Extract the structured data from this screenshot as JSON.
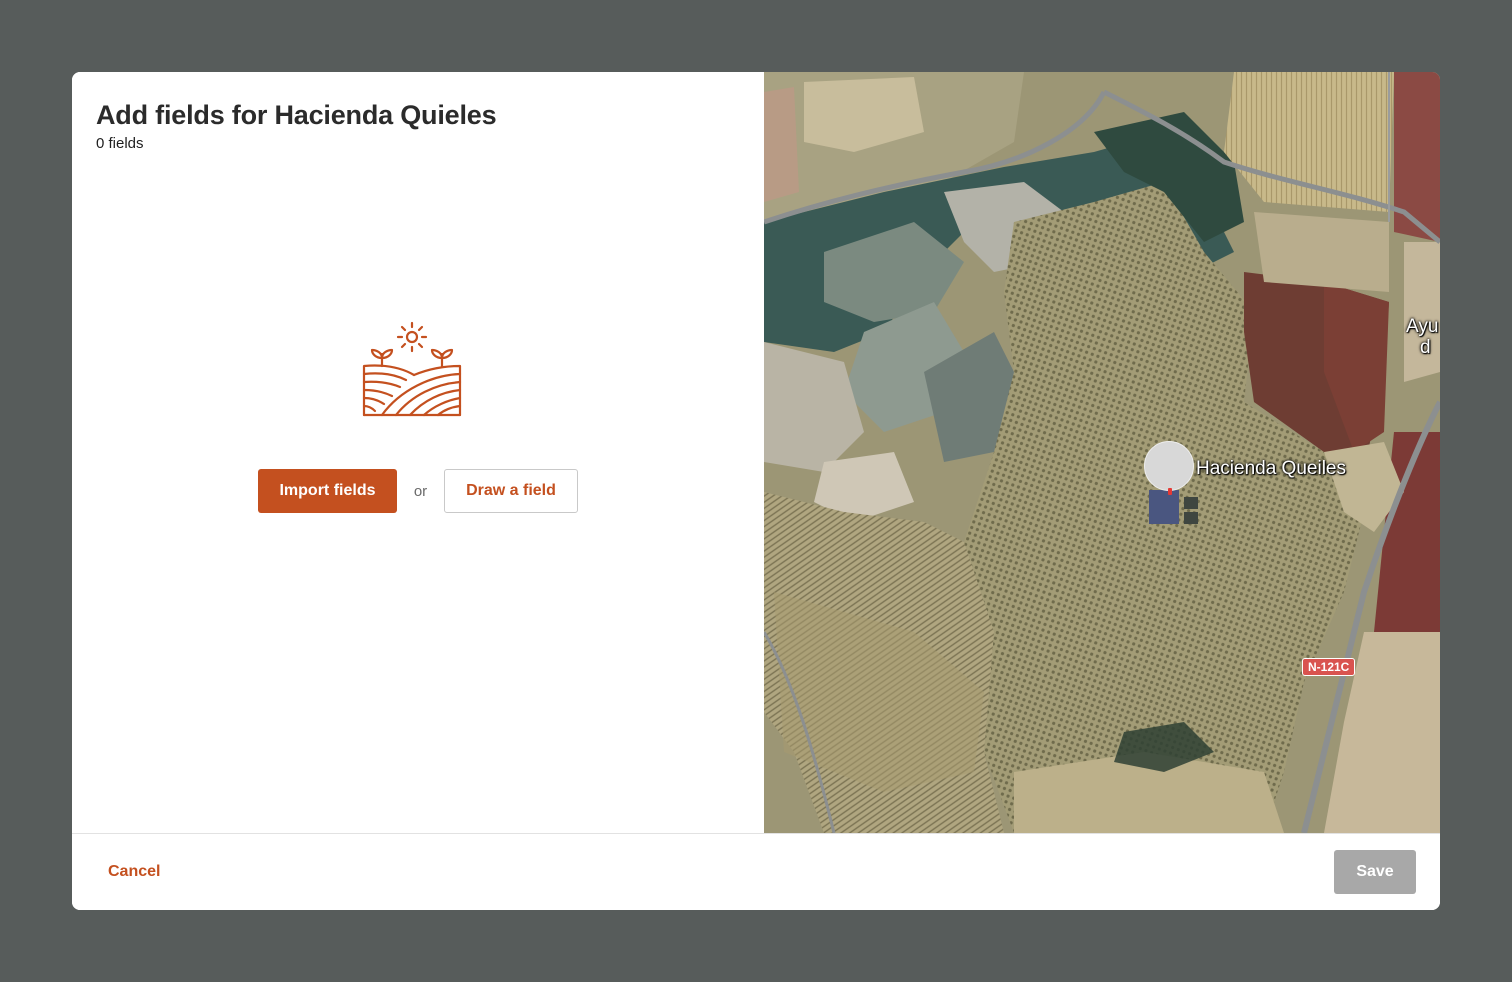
{
  "modal": {
    "title": "Add fields for Hacienda Quieles",
    "field_count": "0 fields"
  },
  "empty_state": {
    "icon": "field-sprout-sun-icon",
    "import_label": "Import fields",
    "or_label": "or",
    "draw_label": "Draw a field"
  },
  "map": {
    "type": "satellite",
    "place_label": "Hacienda Queiles",
    "edge_label_line1": "Ayu",
    "edge_label_line2": "d",
    "road_badge": "N-121C"
  },
  "footer": {
    "cancel_label": "Cancel",
    "save_label": "Save"
  },
  "colors": {
    "accent": "#c4501f",
    "backdrop": "#575c5b",
    "disabled": "#a8a8a8"
  }
}
